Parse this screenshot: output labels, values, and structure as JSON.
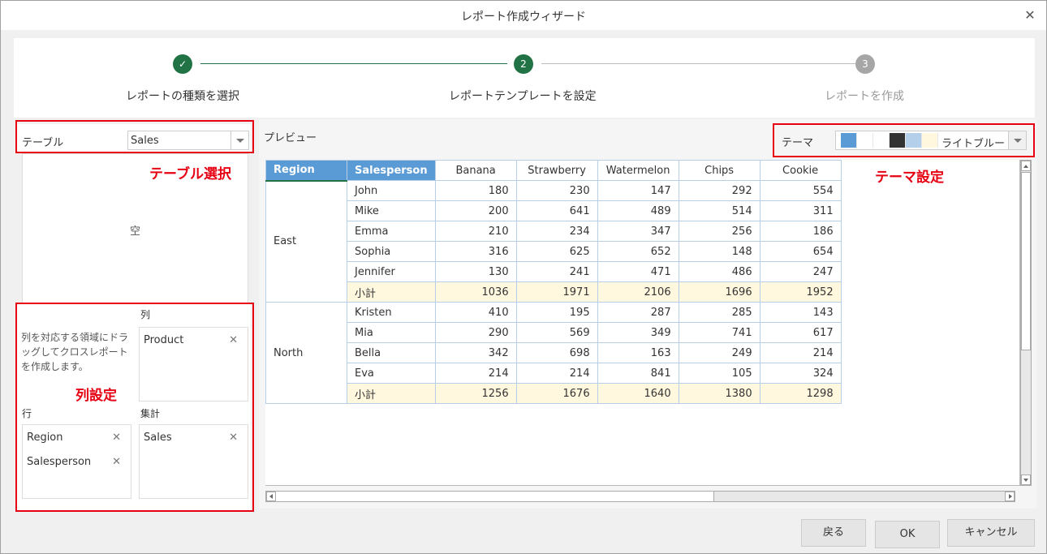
{
  "window": {
    "title": "レポート作成ウィザード",
    "close_icon": "close-icon"
  },
  "stepper": {
    "steps": [
      {
        "label": "レポートの種類を選択",
        "marker": "✓",
        "state": "completed"
      },
      {
        "label": "レポートテンプレートを設定",
        "marker": "2",
        "state": "active"
      },
      {
        "label": "レポートを作成",
        "marker": "3",
        "state": "pending"
      }
    ]
  },
  "left_panel": {
    "table_label": "テーブル",
    "table_value": "Sales",
    "field_list_empty": "空",
    "hint": "列を対応する領域にドラッグしてクロスレポートを作成します。",
    "columns_label": "列",
    "columns": [
      "Product"
    ],
    "rows_label": "行",
    "rows": [
      "Region",
      "Salesperson"
    ],
    "values_label": "集計",
    "values": [
      "Sales"
    ],
    "remove_glyph": "✕"
  },
  "preview": {
    "label": "プレビュー",
    "theme_label": "テーマ",
    "theme_value": "ライトブルー",
    "theme_swatches": [
      "#5b9bd5",
      "#ffffff",
      "#ffffff",
      "#333333",
      "#b4cfea",
      "#fff7de"
    ],
    "headers": [
      "Region",
      "Salesperson",
      "Banana",
      "Strawberry",
      "Watermelon",
      "Chips",
      "Cookie"
    ],
    "groups": [
      {
        "region": "East",
        "rows": [
          {
            "name": "John",
            "values": [
              180,
              230,
              147,
              292,
              554
            ]
          },
          {
            "name": "Mike",
            "values": [
              200,
              641,
              489,
              514,
              311
            ]
          },
          {
            "name": "Emma",
            "values": [
              210,
              234,
              347,
              256,
              186
            ]
          },
          {
            "name": "Sophia",
            "values": [
              316,
              625,
              652,
              148,
              654
            ]
          },
          {
            "name": "Jennifer",
            "values": [
              130,
              241,
              471,
              486,
              247
            ]
          }
        ],
        "subtotal": {
          "name": "小計",
          "values": [
            1036,
            1971,
            2106,
            1696,
            1952
          ]
        }
      },
      {
        "region": "North",
        "rows": [
          {
            "name": "Kristen",
            "values": [
              410,
              195,
              287,
              285,
              143
            ]
          },
          {
            "name": "Mia",
            "values": [
              290,
              569,
              349,
              741,
              617
            ]
          },
          {
            "name": "Bella",
            "values": [
              342,
              698,
              163,
              249,
              214
            ]
          },
          {
            "name": "Eva",
            "values": [
              214,
              214,
              841,
              105,
              324
            ]
          }
        ],
        "subtotal": {
          "name": "小計",
          "values": [
            1256,
            1676,
            1640,
            1380,
            1298
          ]
        }
      }
    ]
  },
  "footer": {
    "back": "戻る",
    "ok": "OK",
    "cancel": "キャンセル"
  },
  "annotations": {
    "table_select": "テーブル選択",
    "column_settings": "列設定",
    "theme_settings": "テーマ設定",
    "color": "#e60012"
  }
}
